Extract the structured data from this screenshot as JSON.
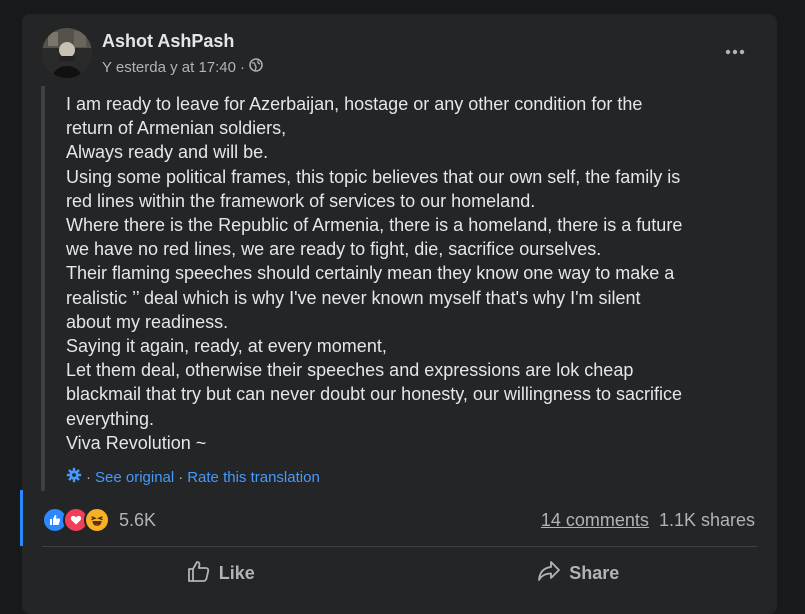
{
  "post": {
    "author": "Ashot AshPash",
    "timestamp": "Y esterda y at 17:40",
    "privacy_icon": "globe-icon",
    "lines": [
      "I am ready to leave for Azerbaijan, hostage or any other condition for the",
      "return of Armenian soldiers,",
      "Always ready and will be.",
      "Using some political frames, this topic believes that our own self, the family is",
      "red lines within the framework of services to our homeland.",
      "Where there is the Republic of Armenia, there is a homeland, there is a future",
      "we have no red lines, we are ready to fight, die, sacrifice ourselves.",
      "Their flaming speeches should certainly mean they know one way to make a",
      "realistic ’’ deal which is why I've never known myself that's why I'm silent",
      "about my readiness.",
      "Saying it again, ready, at every moment,",
      "Let them deal, otherwise their speeches and expressions are lok cheap",
      "blackmail that try but can never doubt our honesty, our willingness to sacrifice",
      "everything.",
      "Viva Revolution ~"
    ]
  },
  "translation": {
    "see_original": "See original",
    "rate": "Rate this translation"
  },
  "reactions": {
    "icons": [
      "like-icon",
      "love-icon",
      "haha-icon"
    ],
    "count": "5.6K"
  },
  "stats": {
    "comments": "14 comments",
    "shares": "1.1K shares"
  },
  "actions": {
    "like": "Like",
    "share": "Share"
  },
  "colors": {
    "background": "#18191a",
    "card": "#242526",
    "link": "#4599ff",
    "like_blue": "#2d88ff",
    "love_red": "#f33e58",
    "haha_yellow": "#f7b125"
  }
}
